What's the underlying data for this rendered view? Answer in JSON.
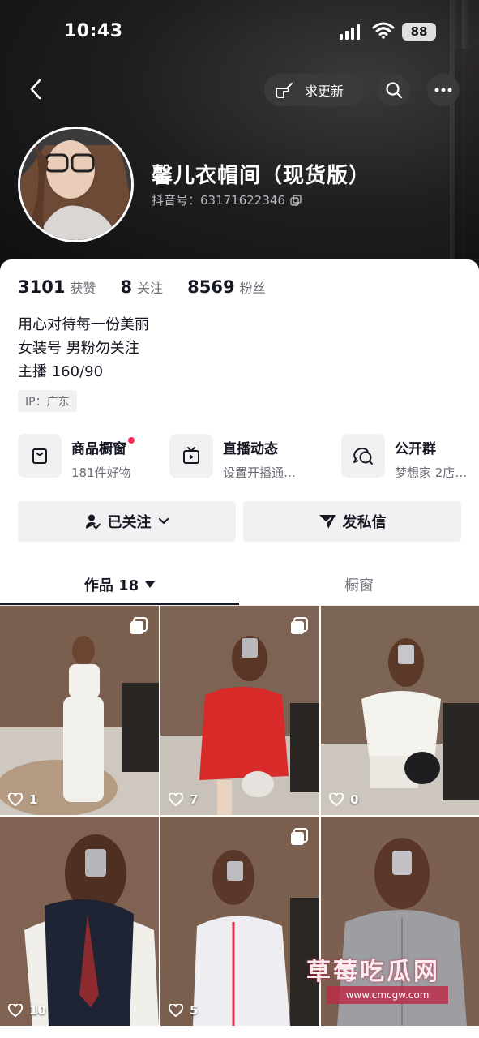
{
  "status_bar": {
    "time": "10:43",
    "battery": "88"
  },
  "topbar": {
    "update_label": "求更新"
  },
  "profile": {
    "name": "馨儿衣帽间（现货版）",
    "douyin_id": "抖音号：63171622346"
  },
  "stats": {
    "likes_value": "3101",
    "likes_label": "获赞",
    "following_value": "8",
    "following_label": "关注",
    "followers_value": "8569",
    "followers_label": "粉丝"
  },
  "bio": {
    "line1": "用心对待每一份美丽",
    "line2": "女装号 男粉勿关注",
    "line3": "主播 160/90"
  },
  "ip_label": "IP：广东",
  "entries": [
    {
      "title": "商品橱窗",
      "subtitle": "181件好物",
      "icon": "shopping-bag-icon",
      "has_dot": true
    },
    {
      "title": "直播动态",
      "subtitle": "设置开播通…",
      "icon": "tv-icon"
    },
    {
      "title": "公开群",
      "subtitle": "梦想家 2店…",
      "icon": "chat-group-icon"
    }
  ],
  "actions": {
    "followed_label": "已关注",
    "message_label": "发私信"
  },
  "tabs": {
    "works_label": "作品 18",
    "showcase_label": "橱窗"
  },
  "posts": [
    {
      "likes": "1",
      "multi": true,
      "outfit": "#f2f0ea"
    },
    {
      "likes": "7",
      "multi": true,
      "outfit": "#d92a2a"
    },
    {
      "likes": "0",
      "multi": false,
      "outfit": "#f4f2ec"
    },
    {
      "likes": "10",
      "multi": false,
      "outfit": "#1e2433"
    },
    {
      "likes": "5",
      "multi": true,
      "outfit": "#eeeef2"
    },
    {
      "likes": "",
      "multi": false,
      "outfit": "#9d9da2"
    }
  ],
  "watermark": {
    "title": "草莓吃瓜网",
    "url": "www.cmcgw.com"
  },
  "colors": {
    "accent_red": "#fe2c55",
    "text_primary": "#161823",
    "text_secondary": "#6b6d75",
    "chip_bg": "#f1f1f2"
  }
}
